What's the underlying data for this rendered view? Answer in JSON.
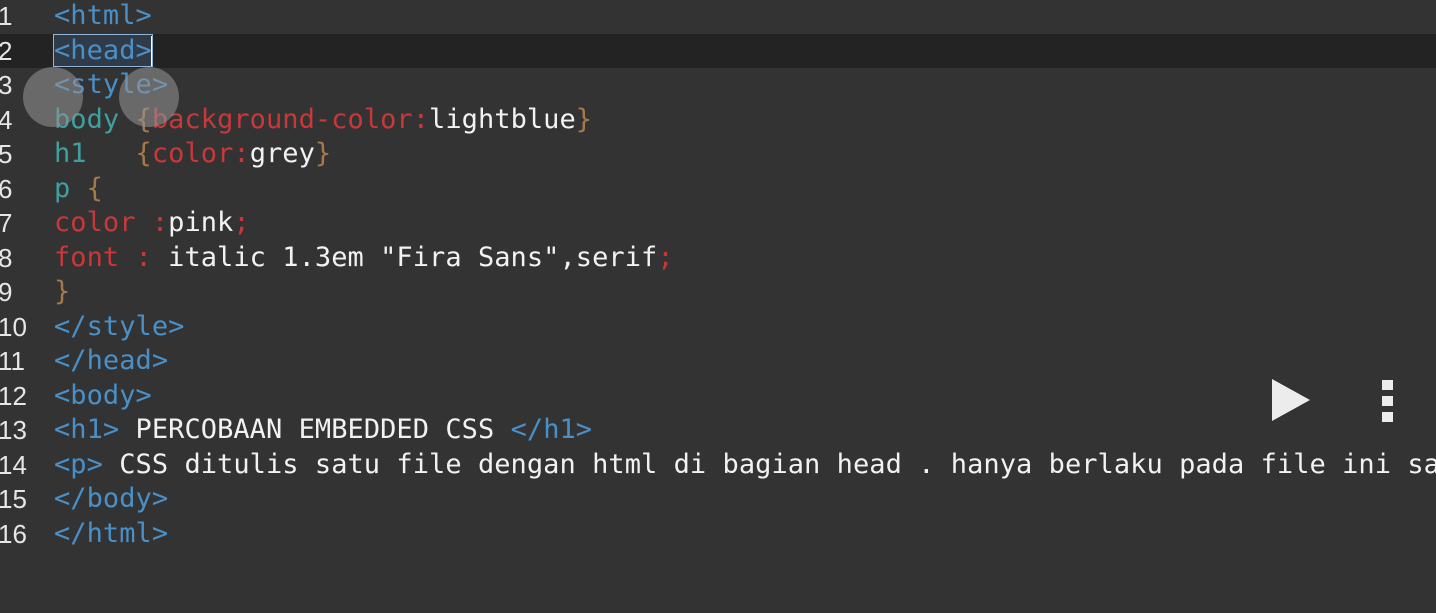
{
  "editor": {
    "cursor_line": 2,
    "lines": [
      {
        "num": "1",
        "tokens": [
          {
            "t": "<html>",
            "c": "tag"
          }
        ]
      },
      {
        "num": "2",
        "tokens": [
          {
            "t": "<head>",
            "c": "tag",
            "match": true
          }
        ]
      },
      {
        "num": "3",
        "tokens": [
          {
            "t": "<style>",
            "c": "tag"
          }
        ]
      },
      {
        "num": "4",
        "tokens": [
          {
            "t": "body ",
            "c": "sel"
          },
          {
            "t": "{",
            "c": "brace"
          },
          {
            "t": "background-color:",
            "c": "prop"
          },
          {
            "t": "lightblue",
            "c": "text"
          },
          {
            "t": "}",
            "c": "brace"
          }
        ]
      },
      {
        "num": "5",
        "tokens": [
          {
            "t": "h1   ",
            "c": "sel"
          },
          {
            "t": "{",
            "c": "brace"
          },
          {
            "t": "color:",
            "c": "prop"
          },
          {
            "t": "grey",
            "c": "text"
          },
          {
            "t": "}",
            "c": "brace"
          }
        ]
      },
      {
        "num": "6",
        "tokens": [
          {
            "t": "p ",
            "c": "sel"
          },
          {
            "t": "{",
            "c": "brace"
          }
        ]
      },
      {
        "num": "7",
        "tokens": [
          {
            "t": "color :",
            "c": "prop"
          },
          {
            "t": "pink",
            "c": "text"
          },
          {
            "t": ";",
            "c": "prop"
          }
        ]
      },
      {
        "num": "8",
        "tokens": [
          {
            "t": "font : ",
            "c": "prop"
          },
          {
            "t": "italic 1.3em \"Fira Sans\",serif",
            "c": "text"
          },
          {
            "t": ";",
            "c": "prop"
          }
        ]
      },
      {
        "num": "9",
        "tokens": [
          {
            "t": "}",
            "c": "brace"
          }
        ]
      },
      {
        "num": "10",
        "tokens": [
          {
            "t": "</style>",
            "c": "tag"
          }
        ]
      },
      {
        "num": "11",
        "tokens": [
          {
            "t": "</head>",
            "c": "tag"
          }
        ]
      },
      {
        "num": "12",
        "tokens": [
          {
            "t": "<body>",
            "c": "tag"
          }
        ]
      },
      {
        "num": "13",
        "tokens": [
          {
            "t": "<h1>",
            "c": "tag"
          },
          {
            "t": " PERCOBAAN EMBEDDED CSS ",
            "c": "text"
          },
          {
            "t": "</h1>",
            "c": "tag"
          }
        ]
      },
      {
        "num": "14",
        "tokens": [
          {
            "t": "<p>",
            "c": "tag"
          },
          {
            "t": " CSS ditulis satu file dengan html di bagian head . hanya berlaku pada file ini saja",
            "c": "text"
          }
        ]
      },
      {
        "num": "15",
        "tokens": [
          {
            "t": "</body>",
            "c": "tag"
          }
        ]
      },
      {
        "num": "16",
        "tokens": [
          {
            "t": "</html>",
            "c": "tag"
          }
        ]
      }
    ]
  },
  "toolbar": {
    "run_icon": "play-icon",
    "menu_icon": "more-vertical-icon"
  },
  "colors": {
    "background": "#333333",
    "active_line": "#232323",
    "tag": "#4a90c8",
    "selector": "#3fa0a0",
    "brace": "#a57a4a",
    "property": "#c8383a",
    "text": "#f2f2f2"
  }
}
